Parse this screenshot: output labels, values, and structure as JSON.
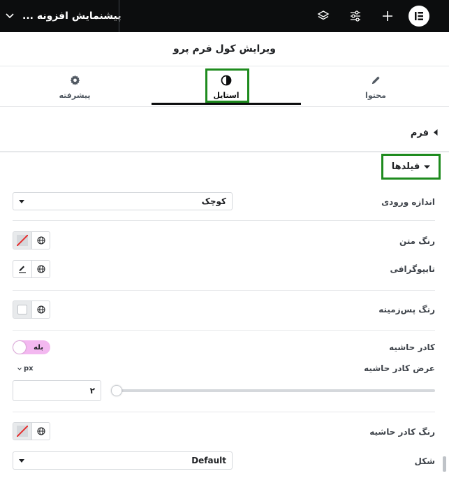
{
  "topbar": {
    "preview_title": "پیشنمایش افزونه ...",
    "icons": [
      "chevron-down-icon",
      "layers-icon",
      "sliders-icon",
      "plus-icon",
      "elementor-logo-icon"
    ]
  },
  "editor": {
    "title": "ویرایش کول فرم پرو"
  },
  "tabs": [
    {
      "label": "محتوا",
      "icon": "pencil-icon"
    },
    {
      "label": "استایل",
      "icon": "half-circle-icon",
      "active": true
    },
    {
      "label": "پیشرفته",
      "icon": "gear-icon"
    }
  ],
  "sections": {
    "form": "فرم",
    "fields": "فیلدها"
  },
  "controls": {
    "input_size_label": "اندازه ورودی",
    "input_size_value": "کوچک",
    "text_color_label": "رنگ متن",
    "typography_label": "تایپوگرافی",
    "bg_color_label": "رنگ پس‌زمینه",
    "border_label": "کادر حاشیه",
    "border_toggle_value": "بله",
    "border_width_label": "عرض کادر حاشیه",
    "border_width_unit": "px",
    "border_width_value": "۲",
    "border_width_slider_value": 2,
    "border_color_label": "رنگ کادر حاشیه",
    "shape_label": "شکل",
    "shape_value": "Default"
  },
  "colors": {
    "highlight": "#1e8b1e",
    "toggle_on": "#f3b8f0",
    "topbar_bg": "#0c0d0e"
  }
}
